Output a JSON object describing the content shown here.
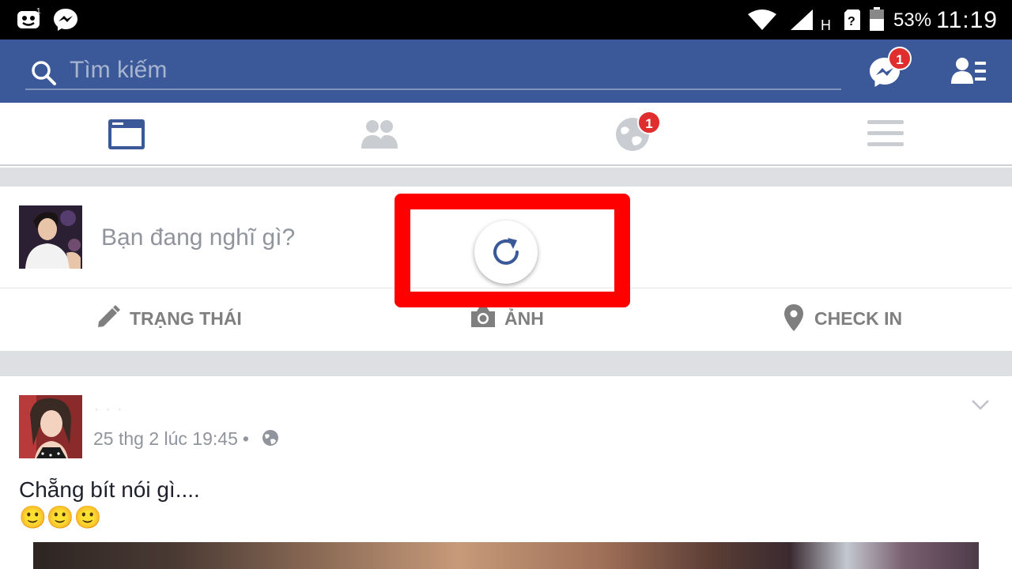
{
  "status_bar": {
    "battery_percent": "53%",
    "time": "11:19",
    "network_type": "H",
    "icons": [
      "assistant-icon",
      "messenger-notification-icon",
      "wifi-icon",
      "signal-icon",
      "sim-unknown-icon",
      "battery-icon"
    ]
  },
  "top_bar": {
    "search_placeholder": "Tìm kiếm",
    "messenger_badge": "1",
    "brand_color": "#3b5998"
  },
  "tabs": [
    {
      "name": "news-feed",
      "icon": "news-feed-icon",
      "active": true
    },
    {
      "name": "friend-requests",
      "icon": "friends-icon",
      "active": false
    },
    {
      "name": "notifications",
      "icon": "globe-icon",
      "badge": "1",
      "active": false
    },
    {
      "name": "more",
      "icon": "menu-icon",
      "active": false
    }
  ],
  "composer": {
    "prompt": "Bạn đang nghĩ gì?",
    "actions": [
      {
        "label": "TRẠNG THÁI",
        "icon": "pencil-icon"
      },
      {
        "label": "ẢNH",
        "icon": "camera-icon"
      },
      {
        "label": "CHECK IN",
        "icon": "location-pin-icon"
      }
    ]
  },
  "refresh": {
    "icon": "refresh-icon",
    "highlight_color": "#ff0000"
  },
  "post": {
    "author": "· · ·",
    "timestamp": "25 thg 2 lúc 19:45",
    "separator": "•",
    "privacy_icon": "globe-icon",
    "text": "Chẵng bít nói gì....",
    "emoji": "🙂🙂🙂"
  }
}
